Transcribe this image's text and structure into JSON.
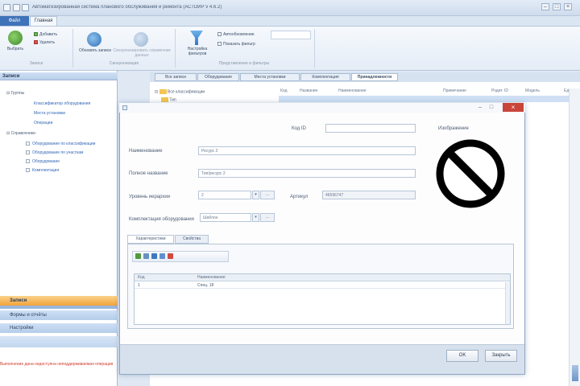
{
  "window": {
    "title": "Автоматизированная система планового обслуживания и ремонта (АСТОИР v 4.6.2)",
    "min": "–",
    "max": "□",
    "close": "×"
  },
  "ribbon": {
    "tabs": [
      "Файл",
      "Главная"
    ],
    "group1": {
      "big_button": "Выбрать",
      "items": [
        "Добавить",
        "Удалить"
      ],
      "label": "Записи"
    },
    "group2": {
      "buttons": [
        "Обновить записи",
        "Синхронизировать справочник данных"
      ],
      "label": "Синхронизация"
    },
    "group3": {
      "button": "Настройка фильтров",
      "checkbox_label": "Автообновление",
      "checkbox2_label": "Показать фильтр",
      "label": "Представление и фильтры"
    }
  },
  "leftpane": {
    "header": "Записи",
    "tree": [
      {
        "label": "Группы",
        "children": [
          "Классификатор оборудования",
          "Места установки",
          "Операции"
        ]
      },
      {
        "label": "Справочники",
        "children": [
          "Оборудование по классификации",
          "Оборудование по участкам",
          "Оборудование",
          "Комплектация"
        ]
      }
    ],
    "nav": [
      "Записи",
      "Формы и отчёты",
      "Настройки"
    ],
    "status": "Выполнение дана недоступна неподдерживаемая операция"
  },
  "main": {
    "tabs": [
      "Все записи",
      "Оборудование",
      "Места установки",
      "Комплектация",
      "Принадлежности"
    ],
    "tree_items": [
      "Все классификации",
      "Тип"
    ],
    "columns": [
      "Код",
      "Название",
      "Наименование",
      "Примечание",
      "Родит. ID",
      "Модель",
      "Ед."
    ]
  },
  "dialog": {
    "id_label": "Код ID",
    "id_value": "",
    "image_label": "Изображение",
    "name_label": "Наименование",
    "name_value": "Ресурс 2",
    "fullname_label": "Полное название",
    "fullname_value": "Тип/ресурс 2",
    "level_label": "Уровень иерархии",
    "level_value": "2",
    "article_label": "Артикул",
    "article_value": "46596747",
    "kit_label": "Комплектация оборудования",
    "kit_value": "Шаблон",
    "inner_tabs": [
      "Характеристики",
      "Свойства"
    ],
    "grid_columns": [
      "Код",
      "Наименование"
    ],
    "grid_row": [
      "1",
      "Спец. 18"
    ],
    "ok": "OK",
    "cancel": "Закрыть"
  }
}
